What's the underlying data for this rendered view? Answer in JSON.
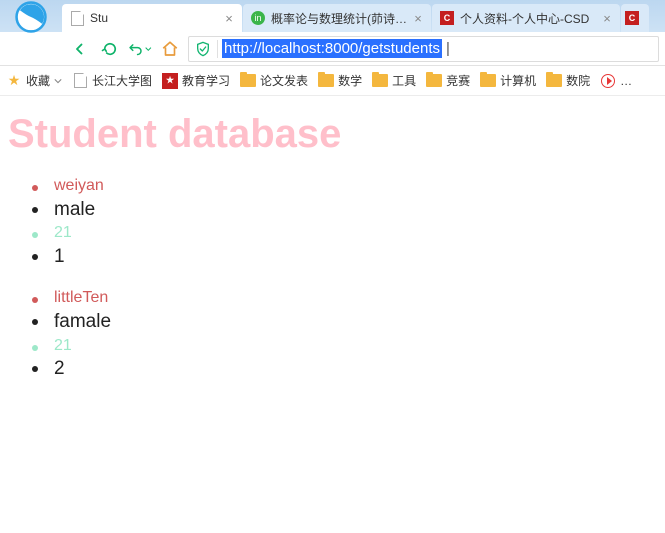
{
  "tabs": [
    {
      "title": "Stu",
      "active": true
    },
    {
      "title": "概率论与数理统计(茆诗…",
      "active": false
    },
    {
      "title": "个人资料-个人中心-CSD",
      "active": false
    }
  ],
  "address": {
    "url": "http://localhost:8000/getstudents"
  },
  "bookmarks": {
    "favorites_label": "收藏",
    "items": [
      {
        "label": "长江大学图",
        "icon": "doc"
      },
      {
        "label": "教育学习",
        "icon": "redflag"
      },
      {
        "label": "论文发表",
        "icon": "folder"
      },
      {
        "label": "数学",
        "icon": "folder"
      },
      {
        "label": "工具",
        "icon": "folder"
      },
      {
        "label": "竞赛",
        "icon": "folder"
      },
      {
        "label": "计算机",
        "icon": "folder"
      },
      {
        "label": "数院",
        "icon": "folder"
      }
    ]
  },
  "page": {
    "heading": "Student database",
    "students": [
      {
        "name": "weiyan",
        "sex": "male",
        "age": "21",
        "index": "1"
      },
      {
        "name": "littleTen",
        "sex": "famale",
        "age": "21",
        "index": "2"
      }
    ]
  }
}
